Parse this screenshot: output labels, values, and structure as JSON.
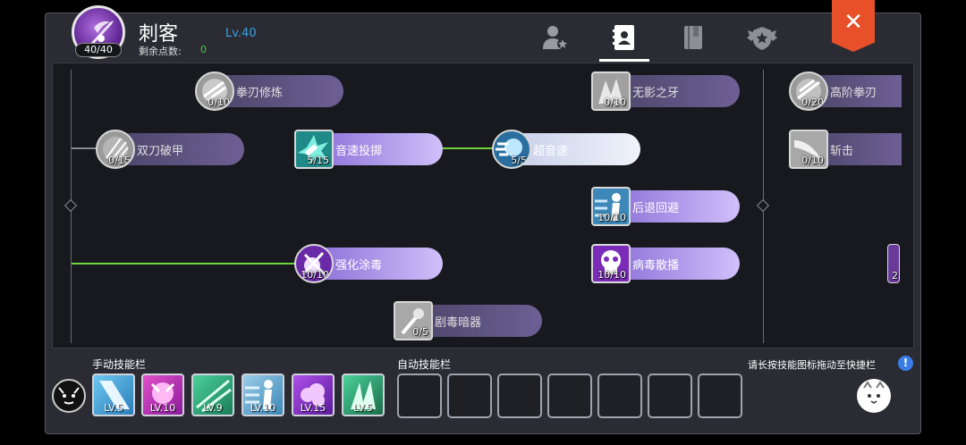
{
  "header": {
    "class_name": "刺客",
    "level": "Lv.40",
    "points_label": "剩余点数:",
    "points_value": "0",
    "avatar_count": "40/40"
  },
  "tabs": [
    {
      "name": "character-tab",
      "icon": "person-star-icon"
    },
    {
      "name": "skills-tab",
      "icon": "contact-book-icon",
      "active": true
    },
    {
      "name": "book-tab",
      "icon": "book-icon"
    },
    {
      "name": "emblem-tab",
      "icon": "winged-star-emblem-icon"
    }
  ],
  "skills": [
    {
      "name": "拳刃修炼",
      "count": "0/10"
    },
    {
      "name": "双刀破甲",
      "count": "0/15"
    },
    {
      "name": "音速投掷",
      "count": "5/15"
    },
    {
      "name": "超音速",
      "count": "5/5"
    },
    {
      "name": "强化涂毒",
      "count": "10/10"
    },
    {
      "name": "剧毒暗器",
      "count": "0/5"
    },
    {
      "name": "无影之牙",
      "count": "0/10"
    },
    {
      "name": "后退回避",
      "count": "10/10"
    },
    {
      "name": "病毒散播",
      "count": "10/10"
    },
    {
      "name": "高阶拳刃",
      "count": "0/20"
    },
    {
      "name": "斩击",
      "count": "0/10"
    },
    {
      "name": "",
      "count": "2"
    }
  ],
  "manual_bar": {
    "label": "手动技能栏",
    "slots": [
      "LV.5",
      "LV.10",
      "LV.9",
      "LV.10",
      "LV.15",
      "LV.5"
    ]
  },
  "auto_bar": {
    "label": "自动技能栏",
    "empty_slots": 7
  },
  "hint": "请长按技能图标拖动至快捷栏",
  "close_label": "✕",
  "info_label": "!",
  "colors": {
    "accent_green": "#6fd43a",
    "level_blue": "#3ba0e0",
    "close_orange": "#e8502a"
  }
}
